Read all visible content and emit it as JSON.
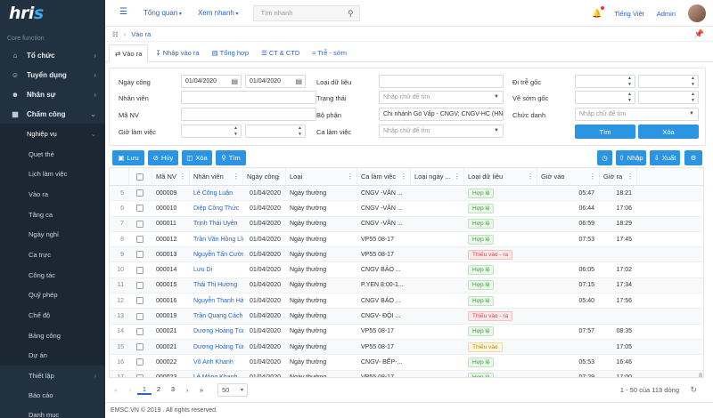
{
  "logo": "hris",
  "sidebar": {
    "section": "Core function",
    "items": [
      {
        "icon": "building-icon",
        "label": "Tổ chức"
      },
      {
        "icon": "recruit-icon",
        "label": "Tuyển dụng"
      },
      {
        "icon": "users-icon",
        "label": "Nhân sự"
      },
      {
        "icon": "calendar-icon",
        "label": "Chấm công"
      }
    ],
    "sub_header": "Nghiệp vụ",
    "sub_items": [
      "Quẹt thẻ",
      "Lịch làm việc",
      "Vào ra",
      "Tăng ca",
      "Ngày nghỉ",
      "Ca trực",
      "Công tác",
      "Quỹ phép",
      "Chế độ",
      "Bảng công",
      "Dự án"
    ],
    "bottom_items": [
      "Thiết lập",
      "Báo cáo",
      "Danh mục"
    ]
  },
  "topbar": {
    "menu1": "Tổng quan",
    "menu2": "Xem nhanh",
    "search_placeholder": "Tìm nhanh",
    "language": "Tiếng Việt",
    "user": "Admin"
  },
  "breadcrumb": "Vào ra",
  "tabs": [
    "Vào ra",
    "Nhập vào ra",
    "Tổng hợp",
    "CT & CTD",
    "Trễ - sớm"
  ],
  "filter": {
    "ngay_cong_label": "Ngày công",
    "date_from": "01/04/2020",
    "date_to": "01/04/2020",
    "nhan_vien_label": "Nhân viên",
    "ma_nv_label": "Mã NV",
    "gio_lam_viec_label": "Giờ làm việc",
    "loai_du_lieu_label": "Loại dữ liệu",
    "trang_thai_label": "Trạng thái",
    "trang_thai_placeholder": "Nhập chữ để tìm",
    "bo_phan_label": "Bộ phận",
    "bo_phan_value": "Chi nhánh Gò Vấp - CNGV; CNGV-HC (HN",
    "ca_lam_viec_label": "Ca làm việc",
    "ca_lam_viec_placeholder": "Nhập chữ để tìm",
    "di_tre_goc_label": "Đi trễ gốc",
    "ve_som_goc_label": "Về sớm gốc",
    "chuc_danh_label": "Chức danh",
    "chuc_danh_placeholder": "Nhập chữ để tìm",
    "search_btn": "Tìm",
    "clear_btn": "Xóa"
  },
  "toolbar": {
    "save": "Lưu",
    "cancel": "Hủy",
    "delete": "Xóa",
    "search": "Tìm",
    "import": "Nhập",
    "export": "Xuất"
  },
  "grid": {
    "headers": [
      "",
      "Mã NV",
      "Nhân viên",
      "Ngày công",
      "Loại",
      "Ca làm việc",
      "Loại ngày ...",
      "Loại dữ liệu",
      "Giờ vào",
      "Giờ ra"
    ],
    "rows": [
      [
        "5",
        "000009",
        "Lê Công Luận",
        "01/04/2020",
        "Ngày thường",
        "CNGV -VĂN ...",
        "",
        "Hợp lệ",
        "05:47",
        "18:21"
      ],
      [
        "6",
        "000010",
        "Diệp Công Thức",
        "01/04/2020",
        "Ngày thường",
        "CNGV -VĂN ...",
        "",
        "Hợp lệ",
        "06:44",
        "17:06"
      ],
      [
        "7",
        "000011",
        "Trịnh Thái Uyên",
        "01/04/2020",
        "Ngày thường",
        "CNGV -VĂN ...",
        "",
        "Hợp lệ",
        "06:59",
        "18:29"
      ],
      [
        "8",
        "000012",
        "Trần Văn Hồng Lĩnh",
        "01/04/2020",
        "Ngày thường",
        "VP55 08-17",
        "",
        "Hợp lệ",
        "07:53",
        "17:45"
      ],
      [
        "9",
        "000013",
        "Nguyễn Tấn Cường",
        "01/04/2020",
        "Ngày thường",
        "VP55 08-17",
        "",
        "Thiếu vào - ra",
        "",
        ""
      ],
      [
        "10",
        "000014",
        "Lưu Di",
        "01/04/2020",
        "Ngày thường",
        "CNGV BẢO ...",
        "",
        "Hợp lệ",
        "06:05",
        "17:02"
      ],
      [
        "11",
        "000015",
        "Thái Thị Hương",
        "01/04/2020",
        "Ngày thường",
        "P.YEN 8:00-1...",
        "",
        "Hợp lệ",
        "07:15",
        "17:34"
      ],
      [
        "12",
        "000016",
        "Nguyễn Thanh Hải",
        "01/04/2020",
        "Ngày thường",
        "CNGV BẢO ...",
        "",
        "Hợp lệ",
        "05:40",
        "17:56"
      ],
      [
        "13",
        "000019",
        "Trần Quang Cách",
        "01/04/2020",
        "Ngày thường",
        "CNGV- ĐỘI ...",
        "",
        "Thiếu vào - ra",
        "",
        ""
      ],
      [
        "14",
        "000021",
        "Dương Hoàng Tùng",
        "01/04/2020",
        "Ngày thường",
        "VP55 08-17",
        "",
        "Hợp lệ",
        "07:57",
        "08:35"
      ],
      [
        "15",
        "000021",
        "Dương Hoàng Tùng",
        "01/04/2020",
        "Ngày thường",
        "VP55 08-17",
        "",
        "Thiếu vào",
        "",
        "17:05"
      ],
      [
        "16",
        "000022",
        "Võ Anh Khanh",
        "01/04/2020",
        "Ngày thường",
        "CNGV- BẾP-...",
        "",
        "Hợp lệ",
        "05:53",
        "16:46"
      ],
      [
        "17",
        "000023",
        "Lê Mộng Khanh",
        "01/04/2020",
        "Ngày thường",
        "VP55 08-17",
        "",
        "Hợp lệ",
        "07:29",
        "17:00"
      ]
    ]
  },
  "pager": {
    "pages": [
      "1",
      "2",
      "3"
    ],
    "page_size": "50",
    "info": "1 - 50 của 113 dòng"
  },
  "footer": "EMSC.VN © 2019 . All rights reserved."
}
